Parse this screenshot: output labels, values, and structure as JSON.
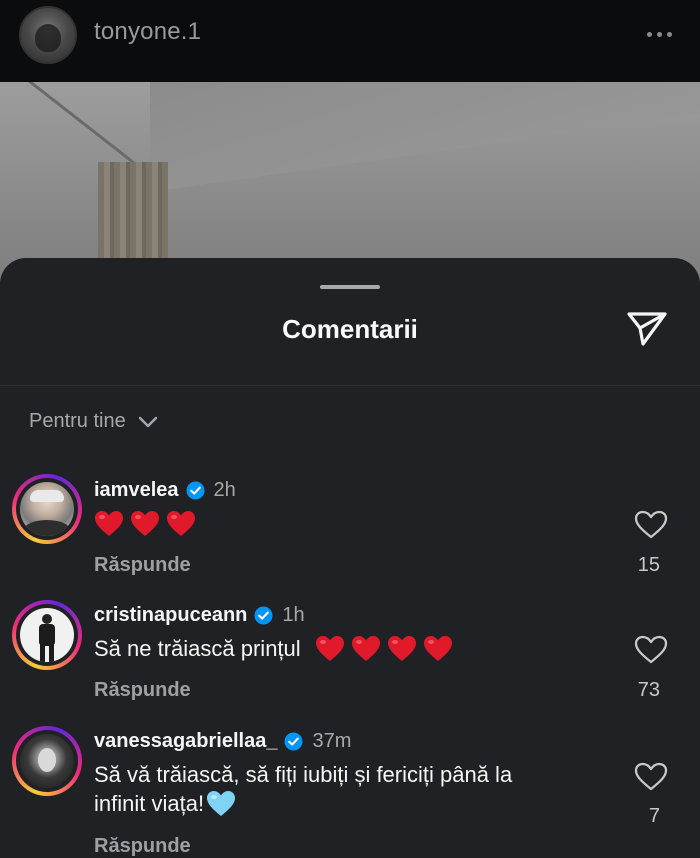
{
  "post": {
    "username": "tonyone.1",
    "more_icon": "more-horizontal-icon"
  },
  "sheet": {
    "title": "Comentarii",
    "share_icon": "send-icon",
    "sort_label": "Pentru tine",
    "sort_icon": "chevron-down-icon"
  },
  "comments": [
    {
      "username": "iamvelea",
      "verified": true,
      "time": "2h",
      "text": "",
      "heart_emojis": 3,
      "reply_label": "Răspunde",
      "likes": "15"
    },
    {
      "username": "cristinapuceann",
      "verified": true,
      "time": "1h",
      "text": "Să ne trăiască prințul",
      "heart_emojis": 4,
      "reply_label": "Răspunde",
      "likes": "73"
    },
    {
      "username": "vanessagabriellaa_",
      "verified": true,
      "time": "37m",
      "text_line1": "Să vă trăiască, să fiți iubiți și fericiți până la",
      "text_line2": "infinit viața!",
      "trailing_emoji": "light-blue-heart",
      "reply_label": "Răspunde",
      "likes": "7"
    }
  ],
  "colors": {
    "sheet_bg": "#1f2125",
    "verified_blue": "#0095f6",
    "heart_red": "#e0192b",
    "light_blue_heart": "#7fd3f5"
  }
}
